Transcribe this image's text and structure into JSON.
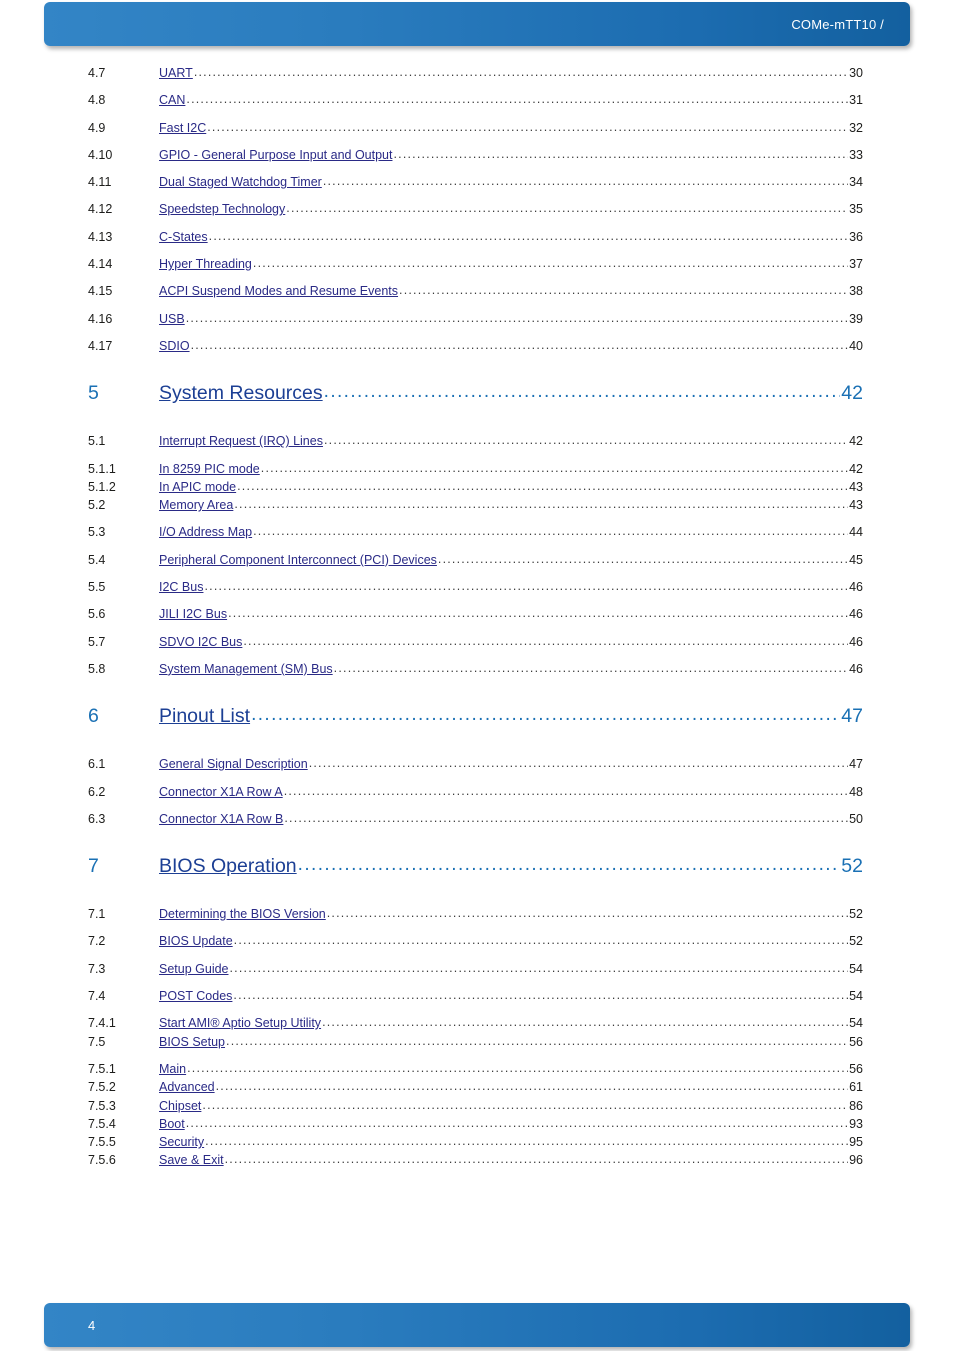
{
  "header": {
    "title": "COMe-mTT10 /"
  },
  "footer": {
    "page_number": "4"
  },
  "colors": {
    "bar_light_blue": "#3385c6",
    "bar_dark_blue": "#13609f",
    "chapter_number_blue": "#1a70b4",
    "chapter_title_blue": "#1c3f94",
    "entry_title_blue": "#2a2a86",
    "entry_text_black": "#1d1d1b"
  },
  "toc": {
    "entries": [
      {
        "level": 2,
        "number": "4.7",
        "title": "UART",
        "page": "30"
      },
      {
        "level": 2,
        "number": "4.8",
        "title": "CAN",
        "page": "31"
      },
      {
        "level": 2,
        "number": "4.9",
        "title": "Fast I2C",
        "page": "32"
      },
      {
        "level": 2,
        "number": "4.10",
        "title": "GPIO - General Purpose Input and Output",
        "page": "33"
      },
      {
        "level": 2,
        "number": "4.11",
        "title": "Dual Staged Watchdog Timer",
        "page": "34"
      },
      {
        "level": 2,
        "number": "4.12",
        "title": "Speedstep Technology",
        "page": "35"
      },
      {
        "level": 2,
        "number": "4.13",
        "title": "C-States",
        "page": "36"
      },
      {
        "level": 2,
        "number": "4.14",
        "title": "Hyper Threading",
        "page": "37"
      },
      {
        "level": 2,
        "number": "4.15",
        "title": "ACPI Suspend Modes and Resume Events",
        "page": "38"
      },
      {
        "level": 2,
        "number": "4.16",
        "title": "USB",
        "page": "39"
      },
      {
        "level": 2,
        "number": "4.17",
        "title": "SDIO",
        "page": "40"
      },
      {
        "level": 1,
        "number": "5",
        "title": "System Resources",
        "page": "42"
      },
      {
        "level": 2,
        "number": "5.1",
        "title": "Interrupt Request (IRQ) Lines",
        "page": "42"
      },
      {
        "level": 3,
        "number": "5.1.1",
        "title": "In 8259 PIC mode",
        "page": "42"
      },
      {
        "level": 3,
        "number": "5.1.2",
        "title": "In APIC mode",
        "page": "43"
      },
      {
        "level": 2,
        "number": "5.2",
        "title": "Memory Area",
        "page": "43"
      },
      {
        "level": 2,
        "number": "5.3",
        "title": "I/O Address Map",
        "page": "44"
      },
      {
        "level": 2,
        "number": "5.4",
        "title": "Peripheral Component Interconnect (PCI) Devices",
        "page": "45"
      },
      {
        "level": 2,
        "number": "5.5",
        "title": "I2C Bus",
        "page": "46"
      },
      {
        "level": 2,
        "number": "5.6",
        "title": "JILI I2C Bus",
        "page": "46"
      },
      {
        "level": 2,
        "number": "5.7",
        "title": "SDVO I2C Bus",
        "page": "46"
      },
      {
        "level": 2,
        "number": "5.8",
        "title": "System Management (SM) Bus",
        "page": "46"
      },
      {
        "level": 1,
        "number": "6",
        "title": "Pinout List",
        "page": "47"
      },
      {
        "level": 2,
        "number": "6.1",
        "title": "General Signal Description",
        "page": "47"
      },
      {
        "level": 2,
        "number": "6.2",
        "title": "Connector X1A Row A",
        "page": "48"
      },
      {
        "level": 2,
        "number": "6.3",
        "title": "Connector X1A Row B",
        "page": "50"
      },
      {
        "level": 1,
        "number": "7",
        "title": "BIOS Operation",
        "page": "52"
      },
      {
        "level": 2,
        "number": "7.1",
        "title": "Determining the BIOS Version",
        "page": "52"
      },
      {
        "level": 2,
        "number": "7.2",
        "title": "BIOS Update",
        "page": "52"
      },
      {
        "level": 2,
        "number": "7.3",
        "title": "Setup Guide",
        "page": "54"
      },
      {
        "level": 2,
        "number": "7.4",
        "title": "POST Codes",
        "page": "54"
      },
      {
        "level": 3,
        "number": "7.4.1",
        "title": "Start AMI® Aptio Setup Utility",
        "page": "54"
      },
      {
        "level": 2,
        "number": "7.5",
        "title": "BIOS Setup",
        "page": "56"
      },
      {
        "level": 3,
        "number": "7.5.1",
        "title": "Main",
        "page": "56"
      },
      {
        "level": 3,
        "number": "7.5.2",
        "title": "Advanced",
        "page": "61"
      },
      {
        "level": 3,
        "number": "7.5.3",
        "title": "Chipset",
        "page": "86"
      },
      {
        "level": 3,
        "number": "7.5.4",
        "title": "Boot",
        "page": "93"
      },
      {
        "level": 3,
        "number": "7.5.5",
        "title": "Security",
        "page": "95"
      },
      {
        "level": 3,
        "number": "7.5.6",
        "title": "Save & Exit",
        "page": "96"
      }
    ]
  }
}
